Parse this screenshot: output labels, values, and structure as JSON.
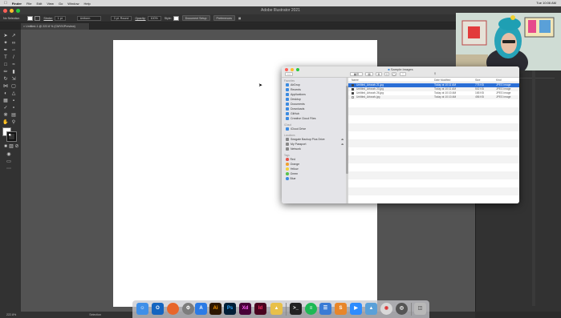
{
  "menubar": {
    "app": "Finder",
    "items": [
      "File",
      "Edit",
      "View",
      "Go",
      "Window",
      "Help"
    ],
    "clock": "Tue 10:06 AM"
  },
  "window_title": "Adobe Illustrator 2021",
  "controlbar": {
    "selection": "No Selection",
    "stroke_label": "Stroke:",
    "stroke_weight": "1 pt",
    "stroke_style": "Uniform",
    "brush": "3 pt. Round",
    "opacity_label": "Opacity:",
    "opacity_value": "100%",
    "style_label": "Style:",
    "doc_setup": "Document Setup",
    "preferences": "Preferences"
  },
  "document_tab": "Untitled-1 @ 222.8 % (CMYK/Preview)",
  "statusbar": {
    "zoom": "222.8%",
    "mode": "Selection"
  },
  "finder": {
    "title": "Sample Images",
    "sidebar": {
      "favorites_head": "Favorites",
      "favorites": [
        "AirDrop",
        "Recents",
        "Applications",
        "Desktop",
        "Documents",
        "Downloads",
        "GitHub",
        "Creative Cloud Files"
      ],
      "icloud_head": "iCloud",
      "icloud": [
        "iCloud Drive"
      ],
      "locations_head": "Locations",
      "locations": [
        "Seagate Backup Plus Drive",
        "My Passport",
        "Network"
      ],
      "tags_head": "Tags",
      "tags": [
        {
          "label": "Red",
          "color": "#e5534b"
        },
        {
          "label": "Orange",
          "color": "#f0a030"
        },
        {
          "label": "Yellow",
          "color": "#f2d03b"
        },
        {
          "label": "Green",
          "color": "#5bc24e"
        },
        {
          "label": "Blue",
          "color": "#3c8be0"
        }
      ]
    },
    "columns": {
      "name": "Name",
      "date": "Date Modified",
      "size": "Size",
      "kind": "Kind"
    },
    "files": [
      {
        "name": "Untitled_Artwork 21.jpg",
        "date": "Today at 10:11 AM",
        "size": "775 KB",
        "kind": "JPEG image"
      },
      {
        "name": "Untitled_Artwork 23.jpg",
        "date": "Today at 10:11 AM",
        "size": "502 KB",
        "kind": "JPEG image"
      },
      {
        "name": "Untitled_Artwork 26.jpg",
        "date": "Today at 10:10 AM",
        "size": "165 KB",
        "kind": "JPEG image"
      },
      {
        "name": "Untitled_Artwork.jpg",
        "date": "Today at 10:10 AM",
        "size": "456 KB",
        "kind": "JPEG image"
      }
    ]
  },
  "dock": [
    {
      "name": "finder",
      "label": "",
      "color": "#3f8fe8"
    },
    {
      "name": "outlook",
      "label": "O",
      "color": "#1565c0"
    },
    {
      "name": "firefox",
      "label": "",
      "color": "#e8662a"
    },
    {
      "name": "system-prefs",
      "label": "",
      "color": "#7d7d7d"
    },
    {
      "name": "app-store",
      "label": "",
      "color": "#2c7be5"
    },
    {
      "name": "illustrator",
      "label": "Ai",
      "color": "#2c1600"
    },
    {
      "name": "photoshop",
      "label": "Ps",
      "color": "#001e36"
    },
    {
      "name": "xd",
      "label": "Xd",
      "color": "#470137"
    },
    {
      "name": "indesign",
      "label": "Id",
      "color": "#49021f"
    },
    {
      "name": "cyberduck",
      "label": "",
      "color": "#e8c04a"
    },
    {
      "name": "terminal",
      "label": "",
      "color": "#222222"
    },
    {
      "name": "spotify",
      "label": "",
      "color": "#1db954"
    },
    {
      "name": "docs",
      "label": "",
      "color": "#3a7bd5"
    },
    {
      "name": "sublime",
      "label": "",
      "color": "#e8862a"
    },
    {
      "name": "zoom",
      "label": "",
      "color": "#2d8cff"
    },
    {
      "name": "preview",
      "label": "",
      "color": "#5aa0d8"
    },
    {
      "name": "chrome",
      "label": "",
      "color": "#d8d8d8"
    },
    {
      "name": "screenshot",
      "label": "",
      "color": "#555555"
    },
    {
      "name": "trash",
      "label": "",
      "color": "#b8b8b8"
    }
  ]
}
